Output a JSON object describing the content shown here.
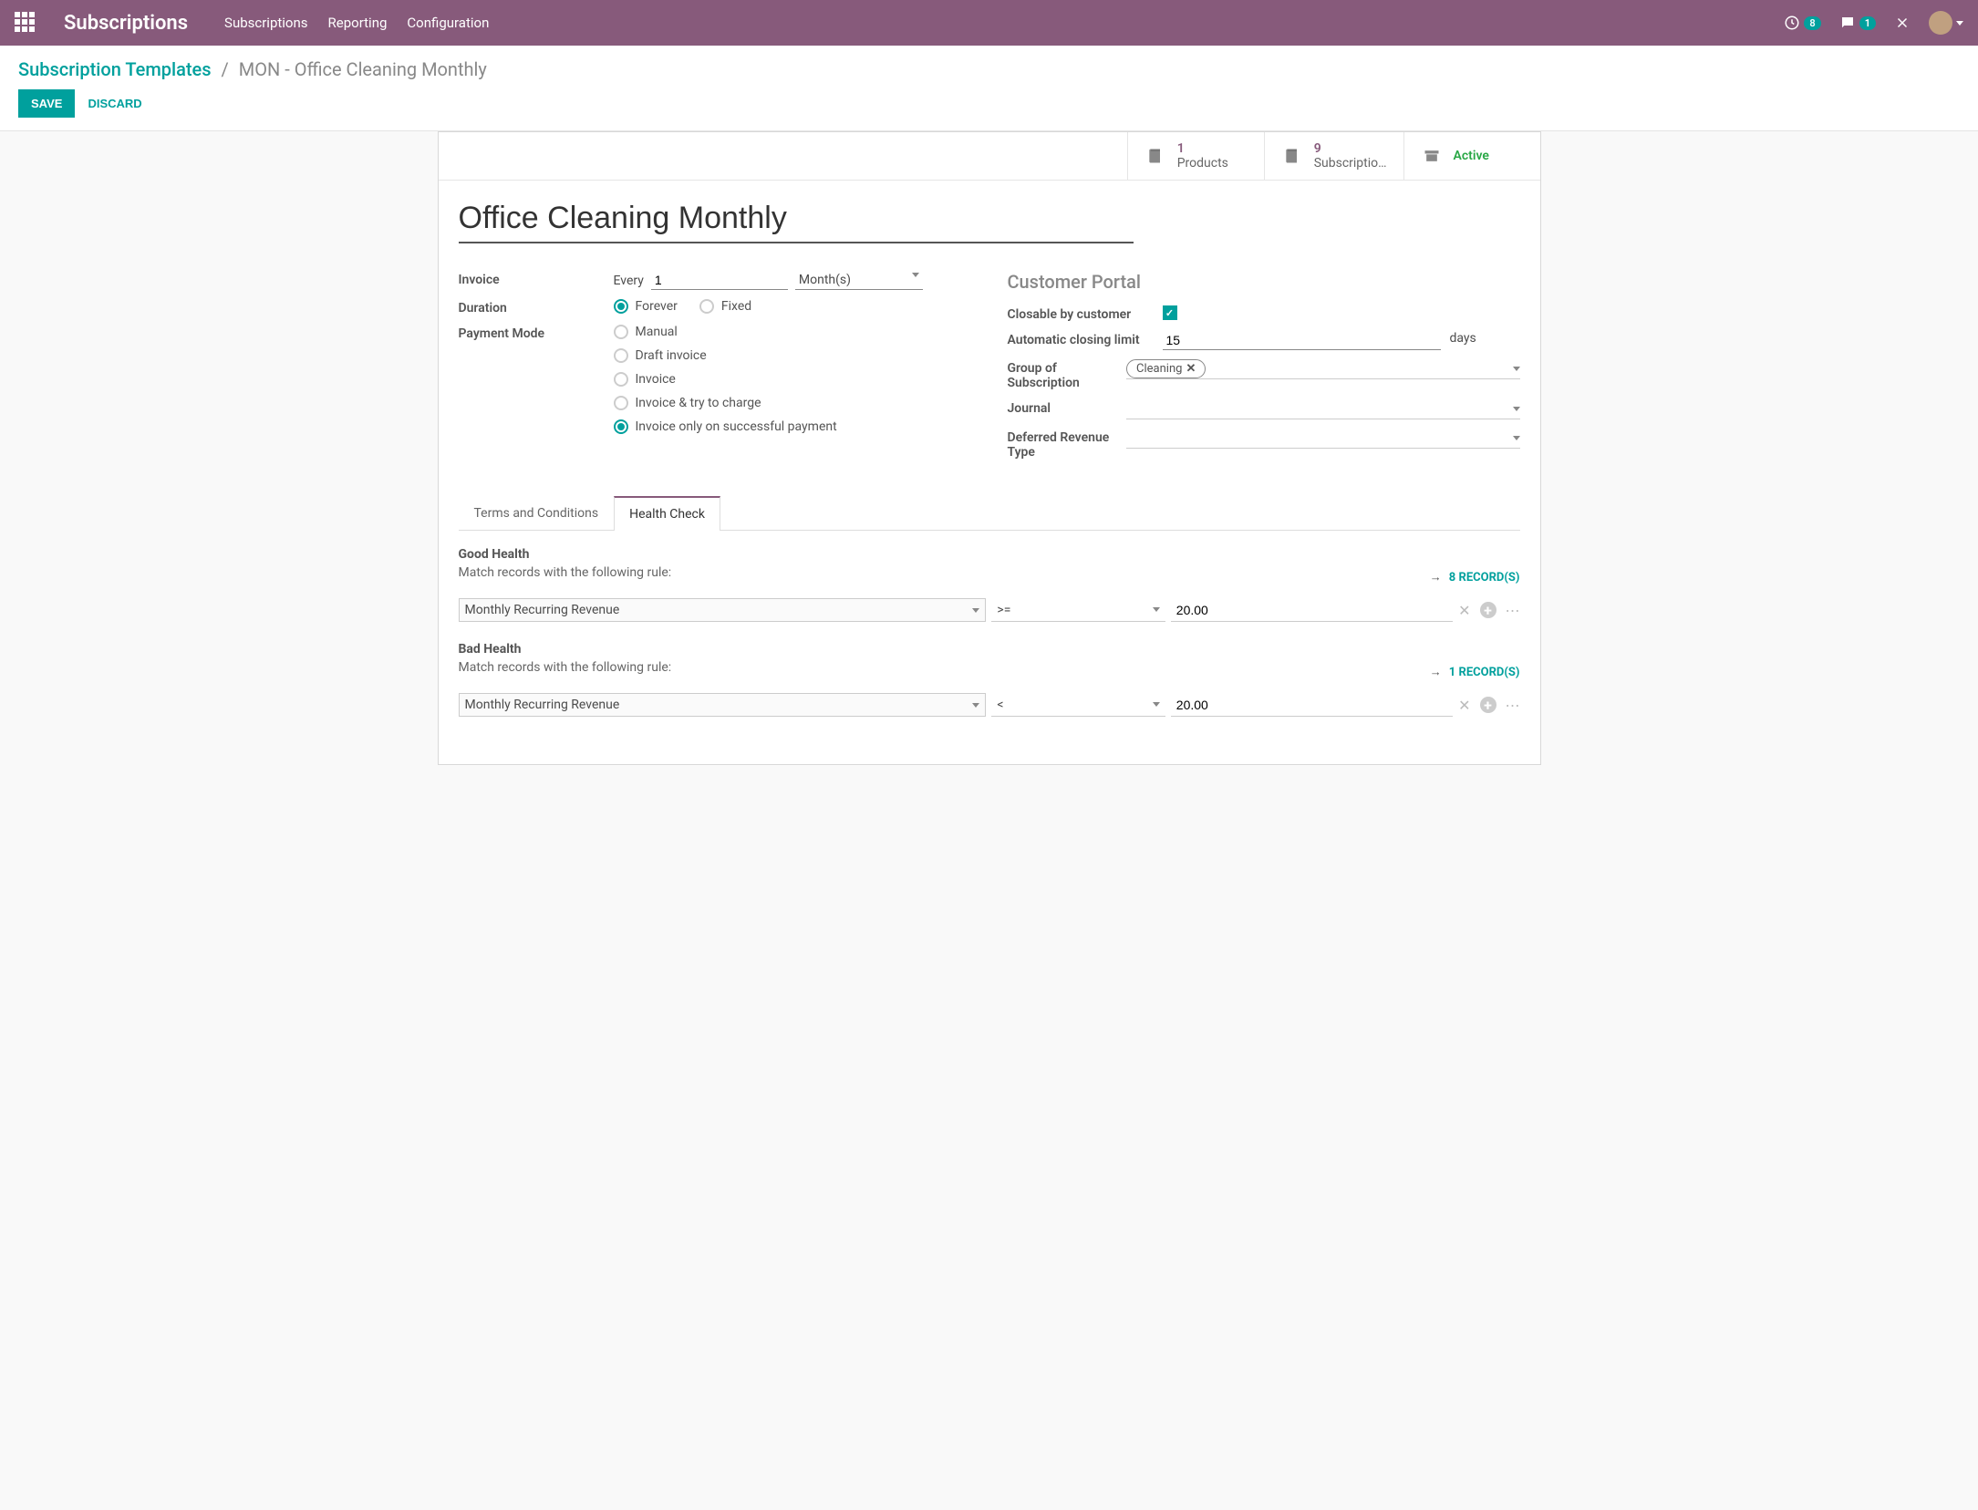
{
  "navbar": {
    "brand": "Subscriptions",
    "links": [
      "Subscriptions",
      "Reporting",
      "Configuration"
    ],
    "timer_badge": "8",
    "msg_badge": "1"
  },
  "breadcrumb": {
    "root": "Subscription Templates",
    "current": "MON - Office Cleaning Monthly"
  },
  "actions": {
    "save": "SAVE",
    "discard": "DISCARD"
  },
  "statbuttons": {
    "products": {
      "count": "1",
      "label": "Products"
    },
    "subscriptions": {
      "count": "9",
      "label": "Subscriptio…"
    },
    "active": "Active"
  },
  "record": {
    "name": "Office Cleaning Monthly",
    "invoice_label": "Invoice",
    "every_label": "Every",
    "every_value": "1",
    "period": "Month(s)",
    "duration_label": "Duration",
    "duration_options": [
      "Forever",
      "Fixed"
    ],
    "payment_label": "Payment Mode",
    "payment_options": [
      "Manual",
      "Draft invoice",
      "Invoice",
      "Invoice & try to charge",
      "Invoice only on successful payment"
    ]
  },
  "portal": {
    "title": "Customer Portal",
    "closable_label": "Closable by customer",
    "auto_close_label": "Automatic closing limit",
    "auto_close_value": "15",
    "days": "days",
    "group_label": "Group of Subscription",
    "group_tag": "Cleaning",
    "journal_label": "Journal",
    "deferred_label": "Deferred Revenue Type"
  },
  "tabs": {
    "terms": "Terms and Conditions",
    "health": "Health Check"
  },
  "health": {
    "good_title": "Good Health",
    "match_text": "Match records with the following rule:",
    "good_records": "8 RECORD(S)",
    "bad_title": "Bad Health",
    "bad_records": "1 RECORD(S)",
    "rule_field": "Monthly Recurring Revenue",
    "good_op": ">=",
    "good_val": "20.00",
    "bad_op": "<",
    "bad_val": "20.00"
  }
}
